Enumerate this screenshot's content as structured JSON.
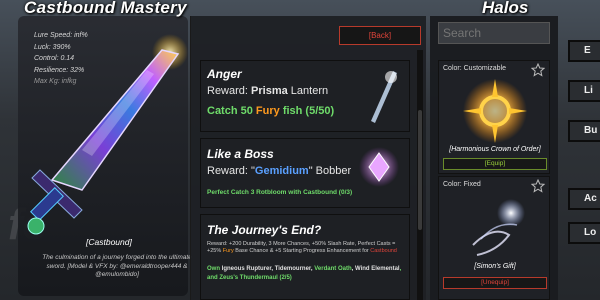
{
  "mastery": {
    "title": "Castbound Mastery",
    "stats": [
      {
        "text": "Lure Speed: inf%",
        "dim": false
      },
      {
        "text": "Luck: 390%",
        "dim": false
      },
      {
        "text": "Control: 0.14",
        "dim": false
      },
      {
        "text": "Resilience: 32%",
        "dim": false
      },
      {
        "text": "Max Kg: infkg",
        "dim": true
      }
    ],
    "item_label": "[Castbound]",
    "item_description": "The culmination of a journey forged into the ultimate sword. [Model & VFX by: @emeraldtrooper444 & @emulombido]",
    "watermark": "fe"
  },
  "quests": {
    "back_label": "[Back]",
    "items": [
      {
        "title": "Anger",
        "reward_prefix": "Reward: ",
        "reward_name": "Prisma",
        "reward_suffix": " Lantern",
        "progress_prefix": "Catch 50 ",
        "progress_highlight": "Fury",
        "progress_suffix": " fish (5/50)"
      },
      {
        "title": "Like a Boss",
        "reward_prefix": "Reward: \"",
        "reward_name": "Gemidium",
        "reward_suffix": "\" Bobber",
        "progress_text": "Perfect Catch 3 Rotbloom with Castbound (0/3)"
      },
      {
        "title": "The Journey's End?",
        "details_a": "Reward: +200 Durability, 3 More Chances, +50% Slash Rate, Perfect Casts = +25% ",
        "details_fury": "Fury",
        "details_b": " Base Chance & +5 Starting Progress Enhancement for ",
        "details_castbound": "Castbound",
        "req_own": "Own ",
        "req_1": "Igneous Rupturer",
        "req_sep1": ", ",
        "req_2": "Tidemourner",
        "req_sep2": ", ",
        "req_3": "Verdant Oath",
        "req_sep3": ", ",
        "req_4": "Wind Elemental",
        "req_and": ", and ",
        "req_5": "Zeus's Thundermaul",
        "req_count": " (2/5)"
      }
    ]
  },
  "halos": {
    "title": "Halos",
    "search_placeholder": "Search",
    "cards": [
      {
        "color_label": "Color: Customizable",
        "name": "[Harmonious Crown of Order]",
        "button": "[Equip]"
      },
      {
        "color_label": "Color: Fixed",
        "name": "[Simon's Gift]",
        "button": "[Unequip]"
      }
    ]
  },
  "side_buttons": [
    "E",
    "Li",
    "Bu",
    "Ac",
    "Lo"
  ],
  "colors": {
    "accent_green": "#6fdc6a",
    "fury_orange": "#ff9a1e",
    "gem_blue": "#5aa0ff",
    "danger_red": "#e0443a"
  }
}
